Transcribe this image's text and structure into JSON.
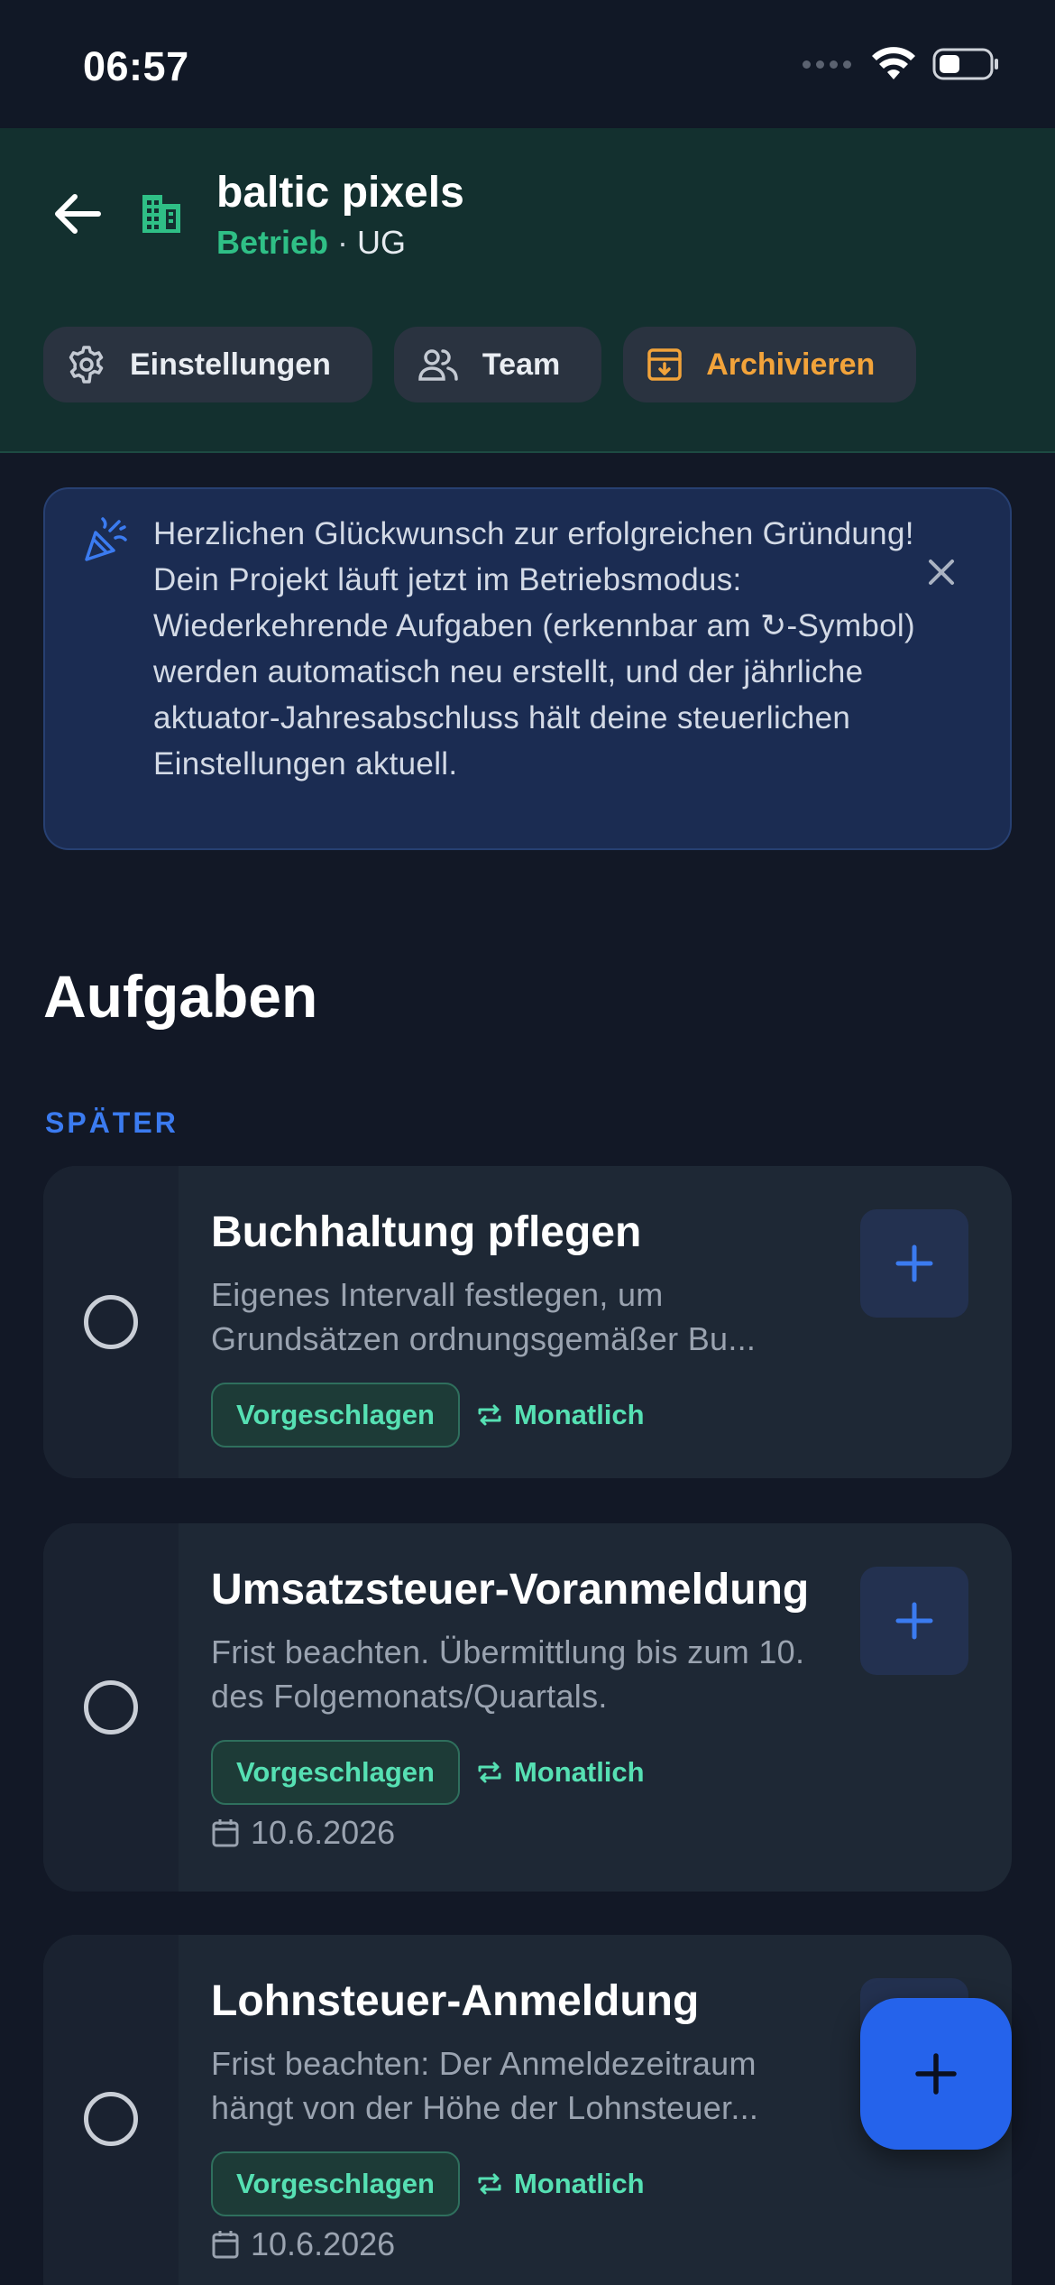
{
  "status_bar": {
    "time": "06:57"
  },
  "header": {
    "title": "baltic pixels",
    "status": "Betrieb",
    "separator": "·",
    "company_type": "UG",
    "chips": [
      {
        "label": "Einstellungen",
        "icon": "gear-icon"
      },
      {
        "label": "Team",
        "icon": "users-icon"
      },
      {
        "label": "Archivieren",
        "icon": "archive-icon",
        "color": "#f2a33a"
      }
    ]
  },
  "banner": {
    "icon": "party-popper-icon",
    "text": "Herzlichen Glückwunsch zur erfolgreichen Gründung! Dein Projekt läuft jetzt im Betriebsmodus: Wiederkehrende Aufgaben (erkennbar am ↻-Symbol) werden automatisch neu erstellt, und der jährliche aktuator-Jahresabschluss hält deine steuerlichen Einstellungen aktuell."
  },
  "section": {
    "title": "Aufgaben",
    "group_label": "SPÄTER"
  },
  "tasks": [
    {
      "title": "Buchhaltung pflegen",
      "description": "Eigenes Intervall festlegen, um Grundsätzen ordnungsgemäßer Bu...",
      "tag": "Vorgeschlagen",
      "recurrence": "Monatlich",
      "date": ""
    },
    {
      "title": "Umsatzsteuer-Voranmeldung",
      "description": "Frist beachten. Übermittlung bis zum 10. des Folgemonats/Quartals.",
      "tag": "Vorgeschlagen",
      "recurrence": "Monatlich",
      "date": "10.6.2026"
    },
    {
      "title": "Lohnsteuer-Anmeldung",
      "description": "Frist beachten: Der Anmeldezeitraum hängt von der Höhe der Lohnsteuer...",
      "tag": "Vorgeschlagen",
      "recurrence": "Monatlich",
      "date": "10.6.2026"
    }
  ],
  "colors": {
    "accent": "#2563eb",
    "success": "#56e0b3",
    "warning": "#f2a33a",
    "header_bg": "#13302f",
    "page_bg": "#121826"
  }
}
